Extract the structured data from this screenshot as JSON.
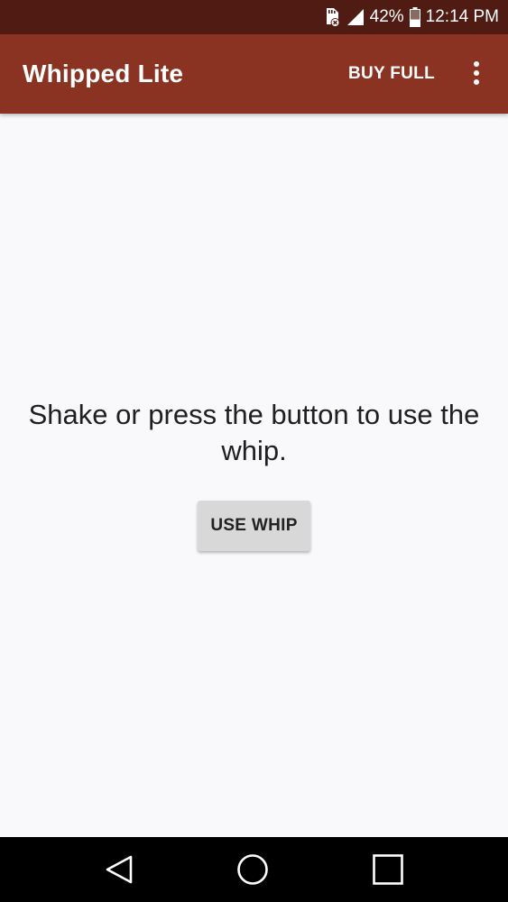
{
  "status_bar": {
    "battery_percent": "42%",
    "time": "12:14 PM",
    "icons": [
      "sd-card-error-icon",
      "signal-icon",
      "battery-icon"
    ],
    "battery_level": 0.42
  },
  "app_bar": {
    "title": "Whipped Lite",
    "buy_full_label": "BUY FULL",
    "overflow_icon": "more-vert-icon"
  },
  "main": {
    "message": "Shake or press the button to use the whip.",
    "button_label": "USE WHIP"
  },
  "nav_bar": {
    "buttons": [
      "back-icon",
      "home-icon",
      "recents-icon"
    ]
  },
  "colors": {
    "status_bar": "#4f1b12",
    "app_bar": "#8a3322",
    "background": "#f9f8fa",
    "button": "#d8d8d8",
    "nav_bar": "#000000"
  }
}
